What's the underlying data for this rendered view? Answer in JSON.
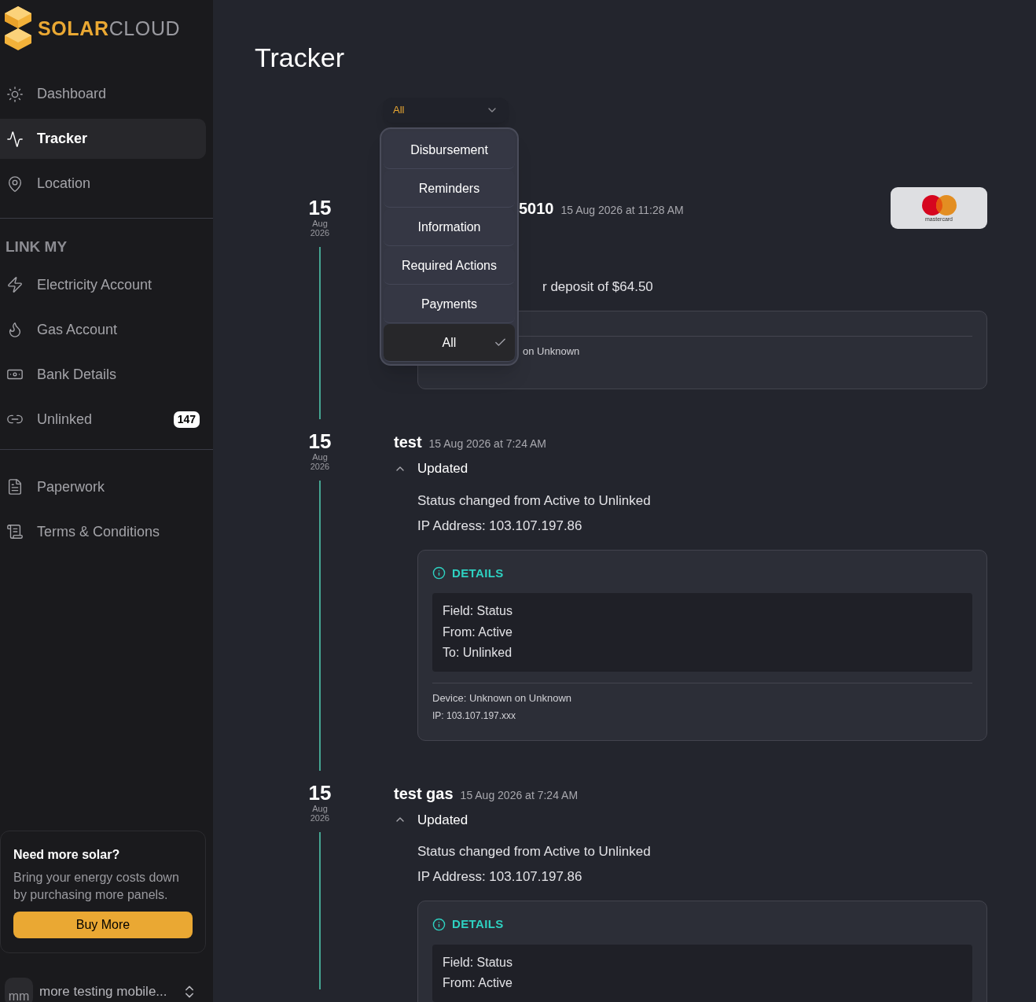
{
  "brand": {
    "part_1": "SOLAR",
    "part_2": "CLOUD"
  },
  "sidebar": {
    "sections": [
      {
        "items": [
          {
            "label": "Dashboard",
            "selected": false
          },
          {
            "label": "Tracker",
            "selected": true
          },
          {
            "label": "Location",
            "selected": false
          }
        ]
      },
      {
        "heading": "LINK MY",
        "items": [
          {
            "label": "Electricity Account",
            "selected": false
          },
          {
            "label": "Gas Account",
            "selected": false
          },
          {
            "label": "Bank Details",
            "selected": false
          },
          {
            "label": "Unlinked",
            "selected": false,
            "badge": "147"
          }
        ]
      },
      {
        "items": [
          {
            "label": "Paperwork",
            "selected": false
          },
          {
            "label": "Terms & Conditions",
            "selected": false
          }
        ]
      }
    ],
    "promo": {
      "title": "Need more solar?",
      "text": "Bring your energy costs down by purchasing more panels.",
      "button": "Buy More"
    },
    "user": {
      "initials": "mm",
      "name": "more testing mobile..."
    }
  },
  "page_title": "Tracker",
  "filter": {
    "value": "All",
    "expanded": true,
    "options": [
      {
        "label": "Disbursement",
        "selected": false
      },
      {
        "label": "Reminders",
        "selected": false
      },
      {
        "label": "Information",
        "selected": false
      },
      {
        "label": "Required Actions",
        "selected": false
      },
      {
        "label": "Payments",
        "selected": false
      },
      {
        "label": "All",
        "selected": true
      }
    ]
  },
  "entries": [
    {
      "day": "15",
      "month": "Aug",
      "year": "2026",
      "title": "5010",
      "time": "15 Aug 2026 at 11:28 AM",
      "card_brand": "mastercard",
      "lines": [
        "r deposit of $64.50"
      ],
      "device": "on Unknown"
    },
    {
      "day": "15",
      "month": "Aug",
      "year": "2026",
      "title": "test",
      "time": "15 Aug 2026 at 7:24 AM",
      "action": "Updated",
      "expanded": true,
      "lines": [
        "Status changed from Active to Unlinked",
        "IP Address: 103.107.197.86"
      ],
      "details_heading": "DETAILS",
      "details": [
        "Field: Status",
        "From: Active",
        "To: Unlinked"
      ],
      "device": "Device: Unknown on Unknown",
      "ip": "IP: 103.107.197.xxx"
    },
    {
      "day": "15",
      "month": "Aug",
      "year": "2026",
      "title": "test gas",
      "time": "15 Aug 2026 at 7:24 AM",
      "action": "Updated",
      "expanded": true,
      "lines": [
        "Status changed from Active to Unlinked",
        "IP Address: 103.107.197.86"
      ],
      "details_heading": "DETAILS",
      "details": [
        "Field: Status",
        "From: Active"
      ]
    }
  ]
}
